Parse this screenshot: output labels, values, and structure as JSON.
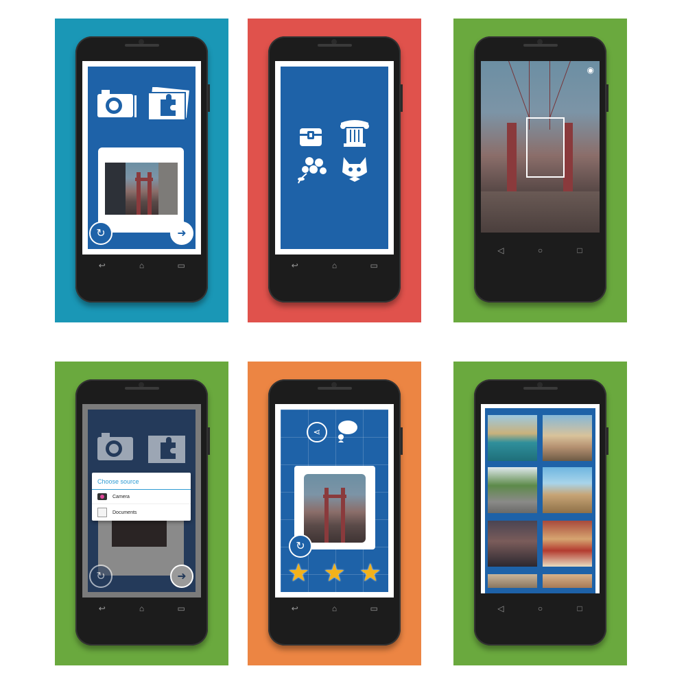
{
  "panels": [
    {
      "id": "p1",
      "bg": "#1a97b6",
      "screen": "main-menu"
    },
    {
      "id": "p2",
      "bg": "#e0524c",
      "screen": "theme-select"
    },
    {
      "id": "p3",
      "bg": "#6aa93e",
      "screen": "photo-preview"
    },
    {
      "id": "p4",
      "bg": "#6aa93e",
      "screen": "choose-source"
    },
    {
      "id": "p5",
      "bg": "#ec8543",
      "screen": "puzzle-complete"
    },
    {
      "id": "p6",
      "bg": "#6aa93e",
      "screen": "gallery"
    }
  ],
  "icons": {
    "camera": "camera-icon",
    "puzzle_gallery": "puzzle-gallery-icon",
    "rotate": "rotate-icon",
    "next": "arrow-right-icon",
    "chest": "treasure-chest-icon",
    "column": "column-icon",
    "flowers": "flowers-icon",
    "cat": "cat-icon",
    "eye": "eye-icon",
    "share": "share-icon",
    "chat": "chat-icon",
    "star": "star-icon"
  },
  "nav_icons": {
    "back_old": "↩",
    "home_old": "⌂",
    "recents_old": "▭",
    "back_new": "◁",
    "home_new": "○",
    "recents_new": "□"
  },
  "dialog": {
    "title": "Choose source",
    "options": [
      {
        "label": "Camera",
        "icon": "camera-icon"
      },
      {
        "label": "Documents",
        "icon": "documents-icon"
      }
    ]
  },
  "stars": [
    "★",
    "★",
    "★"
  ],
  "colors": {
    "app_blue": "#1e62a8",
    "dialog_accent": "#2e9bd3",
    "star": "#f3b21a"
  }
}
